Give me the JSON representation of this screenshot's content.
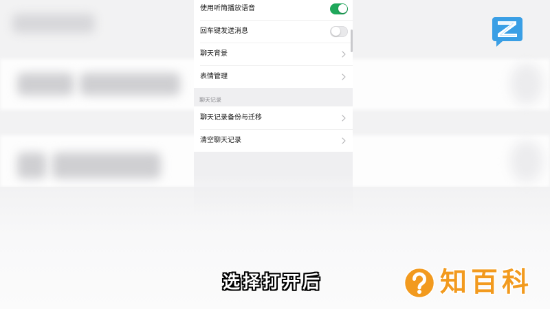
{
  "settings": {
    "group1": [
      {
        "label": "使用听筒播放语音",
        "toggle_on": true
      },
      {
        "label": "回车键发送消息",
        "toggle_on": false
      },
      {
        "label": "聊天背景",
        "icon": "chevron-right-icon"
      },
      {
        "label": "表情管理",
        "icon": "chevron-right-icon"
      }
    ],
    "section_header": "聊天记录",
    "group2": [
      {
        "label": "聊天记录备份与迁移",
        "icon": "chevron-right-icon"
      },
      {
        "label": "清空聊天记录",
        "icon": "chevron-right-icon"
      }
    ]
  },
  "subtitle": "选择打开后",
  "watermark": {
    "icon": "question-circle-icon",
    "text": "知百科"
  },
  "logo": {
    "icon": "speech-bubble-logo-icon"
  },
  "colors": {
    "accent_green": "#1fa85b",
    "watermark_orange": "#f29a1e",
    "logo_blue": "#3a9fe5"
  }
}
